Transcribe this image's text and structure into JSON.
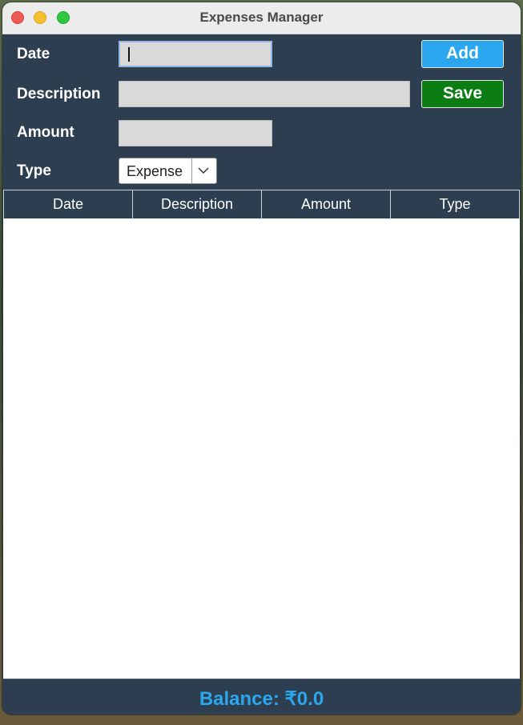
{
  "window": {
    "title": "Expenses Manager"
  },
  "form": {
    "date_label": "Date",
    "description_label": "Description",
    "amount_label": "Amount",
    "type_label": "Type",
    "date_value": "",
    "description_value": "",
    "amount_value": "",
    "type_selected": "Expense"
  },
  "buttons": {
    "add_label": "Add",
    "save_label": "Save"
  },
  "table": {
    "columns": [
      "Date",
      "Description",
      "Amount",
      "Type"
    ],
    "rows": []
  },
  "footer": {
    "balance_text": "Balance: ₹0.0"
  },
  "colors": {
    "panel_bg": "#2d3e50",
    "add_button": "#2aa7ee",
    "save_button": "#0b7d12",
    "balance_text": "#2aa7ee"
  },
  "icons": {
    "close": "close-icon",
    "minimize": "minimize-icon",
    "zoom": "zoom-icon",
    "dropdown": "chevron-down-icon"
  }
}
